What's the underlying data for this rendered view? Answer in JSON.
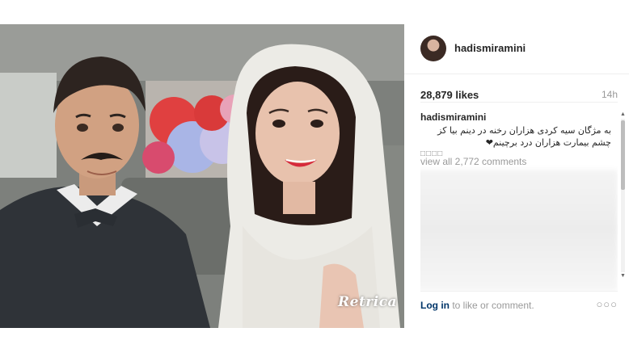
{
  "post": {
    "username": "hadismiramini",
    "likes": "28,879 likes",
    "time": "14h",
    "caption_user": "hadismiramini",
    "caption_text": "به مژگان سیه کردی هزاران رخنه در دینم بیا کز چشم بیمارت هزاران درد برچینم❤",
    "caption_squares": "□□□□",
    "view_all": "view all 2,772 comments",
    "login_link": "Log in",
    "login_suffix": " to like or comment.",
    "more": "○○○"
  },
  "photo": {
    "watermark": "Retrica"
  },
  "icons": {
    "avatar": "profile-avatar",
    "more": "more-options-icon"
  },
  "colors": {
    "link": "#003569",
    "muted": "#999999",
    "text": "#262626",
    "divider": "#efefef"
  }
}
